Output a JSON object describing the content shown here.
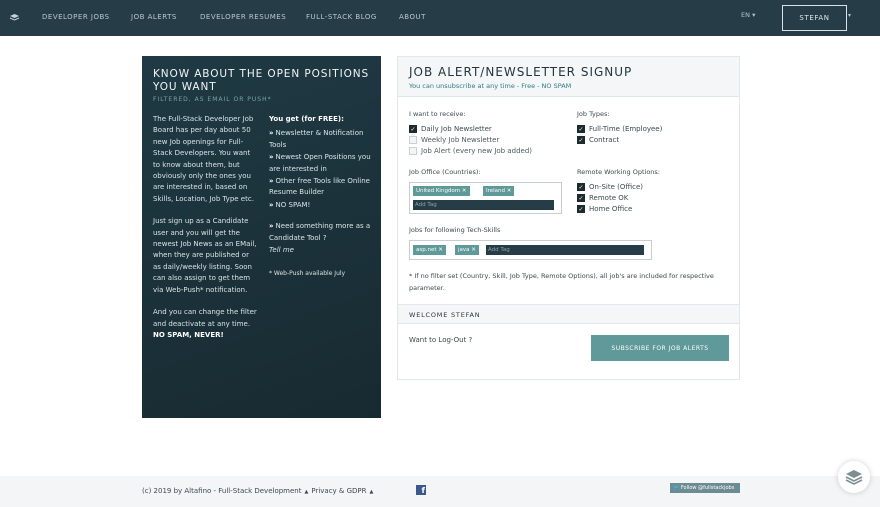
{
  "nav": {
    "items": [
      "DEVELOPER JOBS",
      "JOB ALERTS",
      "DEVELOPER RESUMES",
      "FULL-STACK BLOG",
      "ABOUT"
    ],
    "lang": "EN",
    "user": "STEFAN"
  },
  "info": {
    "title": "KNOW ABOUT THE OPEN POSITIONS YOU WANT",
    "subtitle": "FILTERED, AS EMAIL OR PUSH*",
    "p1": "The Full-Stack Developer Job Board has per day about 50 new Job openings for Full-Stack Developers. You want to know about them, but obviously only the ones you are interested in, based on Skills, Location, Job Type etc.",
    "p2": "Just sign up as a Candidate user and you will get the newest Job News as an EMail, when they are published or as daily/weekly listing. Soon can also assign to get them via Web-Push* notification.",
    "p3": "And you can change the filter and deactivate at any time.",
    "p4": "NO SPAM, NEVER!",
    "free_head": "You get (for FREE):",
    "free_items": [
      "Newsletter & Notification Tools",
      "Newest Open Positions you are interested in",
      "Other free Tools like Online Resume Builder",
      "NO SPAM!"
    ],
    "need": "Need something more as a Candidate Tool ?",
    "tell": "Tell me",
    "note": "* Web-Push available July"
  },
  "form": {
    "title": "JOB ALERT/NEWSLETTER SIGNUP",
    "tagline": "You can unsubscribe at any time - Free - NO SPAM",
    "receive_label": "I want to receive:",
    "receive": [
      {
        "label": "Daily Job Newsletter",
        "checked": true
      },
      {
        "label": "Weekly Job Newsletter",
        "checked": false
      },
      {
        "label": "Job Alert (every new Job added)",
        "checked": false
      }
    ],
    "types_label": "Job Types:",
    "types": [
      {
        "label": "Full-Time (Employee)",
        "checked": true
      },
      {
        "label": "Contract",
        "checked": true
      }
    ],
    "office_label": "Job Office (Countries):",
    "countries": [
      "United Kingdom",
      "Ireland"
    ],
    "add_tag": "Add Tag",
    "remote_label": "Remote Working Options:",
    "remote": [
      {
        "label": "On-Site (Office)",
        "checked": true
      },
      {
        "label": "Remote OK",
        "checked": true
      },
      {
        "label": "Home Office",
        "checked": true
      }
    ],
    "skills_label": "Jobs for following Tech-Skills",
    "skills": [
      "asp.net",
      "java"
    ],
    "footnote": "* If no filter set (Country, Skill, Job Type, Remote Options), all job's are included for respective parameter.",
    "welcome": "WELCOME STEFAN",
    "logout": "Want to Log-Out ?",
    "subscribe": "SUBSCRIBE FOR JOB ALERTS"
  },
  "footer": {
    "copyright": "(c) 2019 by Altafino - Full-Stack Development",
    "privacy": "Privacy & GDPR",
    "twitter": "Follow @fullstackjobs"
  },
  "colors": {
    "nav_bg": "#263d48",
    "accent": "#5f9999",
    "panel_bg": "#1f3a44"
  }
}
